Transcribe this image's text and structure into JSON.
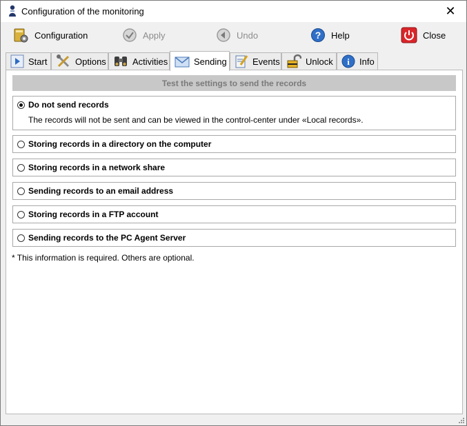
{
  "window": {
    "title": "Configuration of the monitoring",
    "close_symbol": "✕"
  },
  "toolbar": {
    "configuration": "Configuration",
    "apply": "Apply",
    "undo": "Undo",
    "help": "Help",
    "close": "Close"
  },
  "tabs": [
    {
      "label": "Start",
      "icon": "play-icon"
    },
    {
      "label": "Options",
      "icon": "tools-icon"
    },
    {
      "label": "Activities",
      "icon": "binoculars-icon"
    },
    {
      "label": "Sending",
      "icon": "envelope-icon",
      "active": true
    },
    {
      "label": "Events",
      "icon": "notepad-icon"
    },
    {
      "label": "Unlock",
      "icon": "padlock-icon"
    },
    {
      "label": "Info",
      "icon": "info-icon"
    }
  ],
  "content": {
    "test_button": "Test the settings to send the records",
    "options": [
      {
        "label": "Do not send records",
        "selected": true,
        "description": "The records will not be sent and can be viewed in the control-center under «Local records»."
      },
      {
        "label": "Storing records in a directory on the computer",
        "selected": false
      },
      {
        "label": "Storing records in a network share",
        "selected": false
      },
      {
        "label": "Sending records to an email address",
        "selected": false
      },
      {
        "label": "Storing records in a FTP account",
        "selected": false
      },
      {
        "label": "Sending records to the PC Agent Server",
        "selected": false
      }
    ],
    "note": "* This information is required. Others are optional."
  },
  "colors": {
    "close_red": "#d9262b",
    "help_blue": "#2f6fc7",
    "disabled_gray": "#8c8c8c"
  }
}
